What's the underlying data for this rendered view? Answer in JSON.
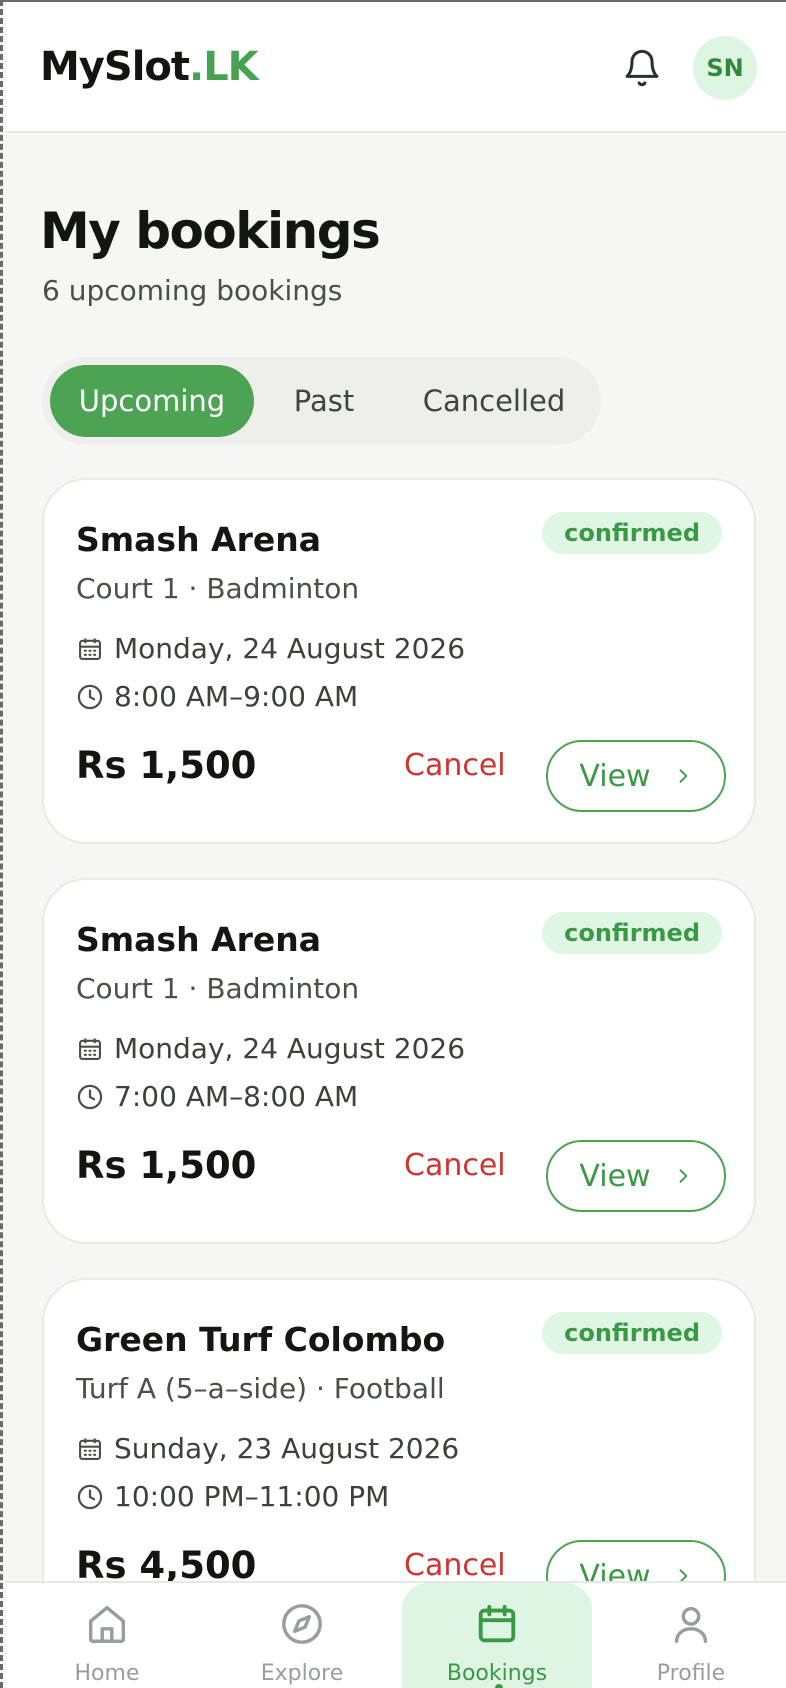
{
  "header": {
    "logo_main": "MySlot",
    "logo_accent": ".LK",
    "avatar_initials": "SN"
  },
  "page": {
    "title": "My bookings",
    "subtitle": "6 upcoming bookings"
  },
  "tabs": [
    {
      "label": "Upcoming",
      "active": true
    },
    {
      "label": "Past",
      "active": false
    },
    {
      "label": "Cancelled",
      "active": false
    }
  ],
  "bookings": [
    {
      "venue": "Smash Arena",
      "court": "Court 1 · Badminton",
      "status": "confirmed",
      "date": "Monday, 24 August 2026",
      "time": "8:00 AM–9:00 AM",
      "price": "Rs 1,500",
      "cancel_label": "Cancel",
      "view_label": "View"
    },
    {
      "venue": "Smash Arena",
      "court": "Court 1 · Badminton",
      "status": "confirmed",
      "date": "Monday, 24 August 2026",
      "time": "7:00 AM–8:00 AM",
      "price": "Rs 1,500",
      "cancel_label": "Cancel",
      "view_label": "View"
    },
    {
      "venue": "Green Turf Colombo",
      "court": "Turf A (5–a–side) · Football",
      "status": "confirmed",
      "date": "Sunday, 23 August 2026",
      "time": "10:00 PM–11:00 PM",
      "price": "Rs 4,500",
      "cancel_label": "Cancel",
      "view_label": "View"
    }
  ],
  "nav": [
    {
      "label": "Home",
      "icon": "home-icon",
      "active": false
    },
    {
      "label": "Explore",
      "icon": "compass-icon",
      "active": false
    },
    {
      "label": "Bookings",
      "icon": "calendar-icon",
      "active": true
    },
    {
      "label": "Profile",
      "icon": "user-icon",
      "active": false
    }
  ],
  "colors": {
    "brand_green": "#4ca354",
    "accent_green_text": "#3a9945",
    "badge_bg": "#e0f6e4",
    "cancel_red": "#cf3430",
    "background": "#f6f7f3"
  }
}
